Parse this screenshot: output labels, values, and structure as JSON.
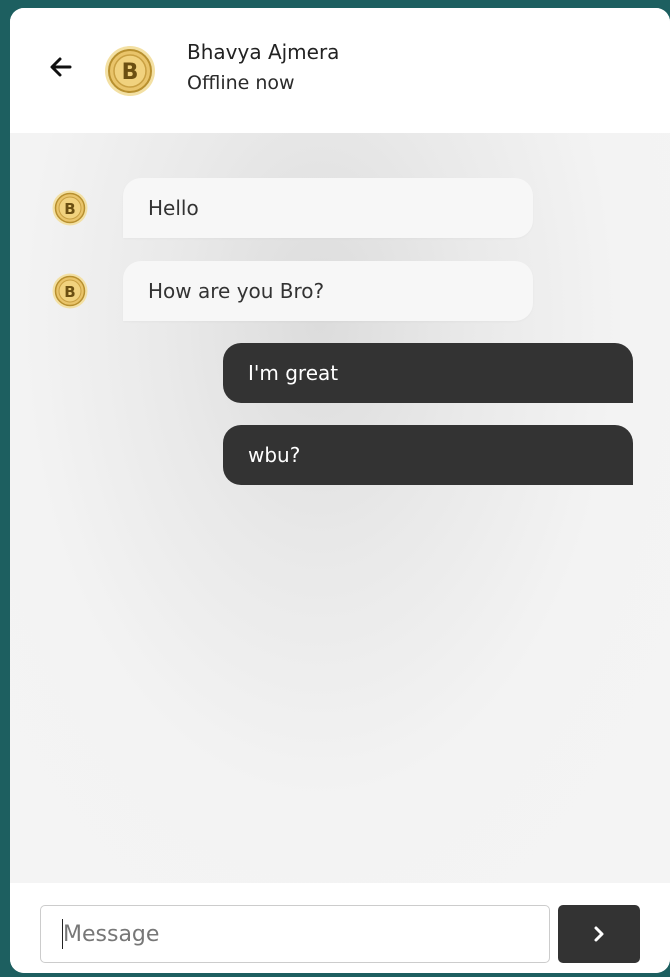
{
  "header": {
    "contact_name": "Bhavya Ajmera",
    "contact_status": "Offline now",
    "avatar_letter": "B"
  },
  "messages": [
    {
      "direction": "incoming",
      "text": "Hello",
      "avatar_letter": "B"
    },
    {
      "direction": "incoming",
      "text": "How are you Bro?",
      "avatar_letter": "B"
    },
    {
      "direction": "outgoing",
      "text": "I'm great"
    },
    {
      "direction": "outgoing",
      "text": "wbu?"
    }
  ],
  "composer": {
    "placeholder": "Message",
    "value": ""
  },
  "colors": {
    "frame": "#1d5f60",
    "outgoing_bubble": "#333333",
    "incoming_bubble": "#f7f7f7",
    "send_button": "#333333",
    "avatar_gold": "#e9c46a"
  },
  "icons": {
    "back": "arrow-left-icon",
    "send": "chevron-right-icon",
    "avatar": "coin-avatar-icon"
  }
}
